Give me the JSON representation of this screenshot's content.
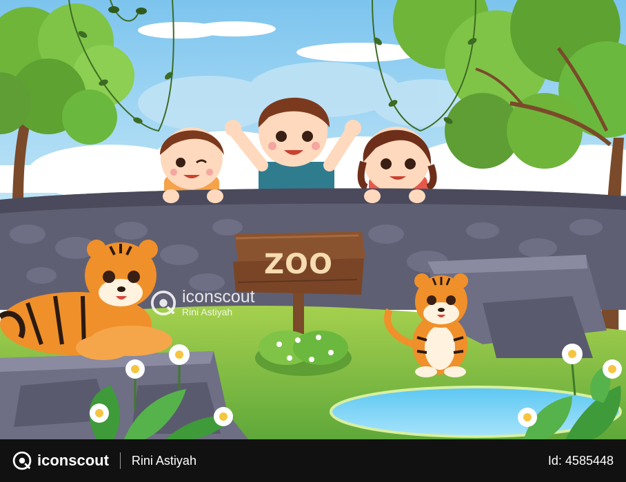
{
  "scene": {
    "sign_text": "ZOO",
    "elements": [
      "sky",
      "clouds",
      "trees",
      "hanging-vines",
      "three-children",
      "stone-wall",
      "wooden-sign",
      "tiger-lying",
      "tiger-cub-sitting",
      "rocks",
      "grass",
      "pond",
      "daisies",
      "leaves"
    ]
  },
  "watermark": {
    "brand": "iconscout",
    "author": "Rini Astiyah"
  },
  "footer": {
    "brand": "iconscout",
    "author": "Rini Astiyah",
    "asset_id": "Id: 4585448"
  },
  "colors": {
    "sky": "#9fd3f2",
    "wall": "#5f5f73",
    "grass": "#8bc34a",
    "tiger": "#f0902a",
    "footer": "#111111"
  }
}
